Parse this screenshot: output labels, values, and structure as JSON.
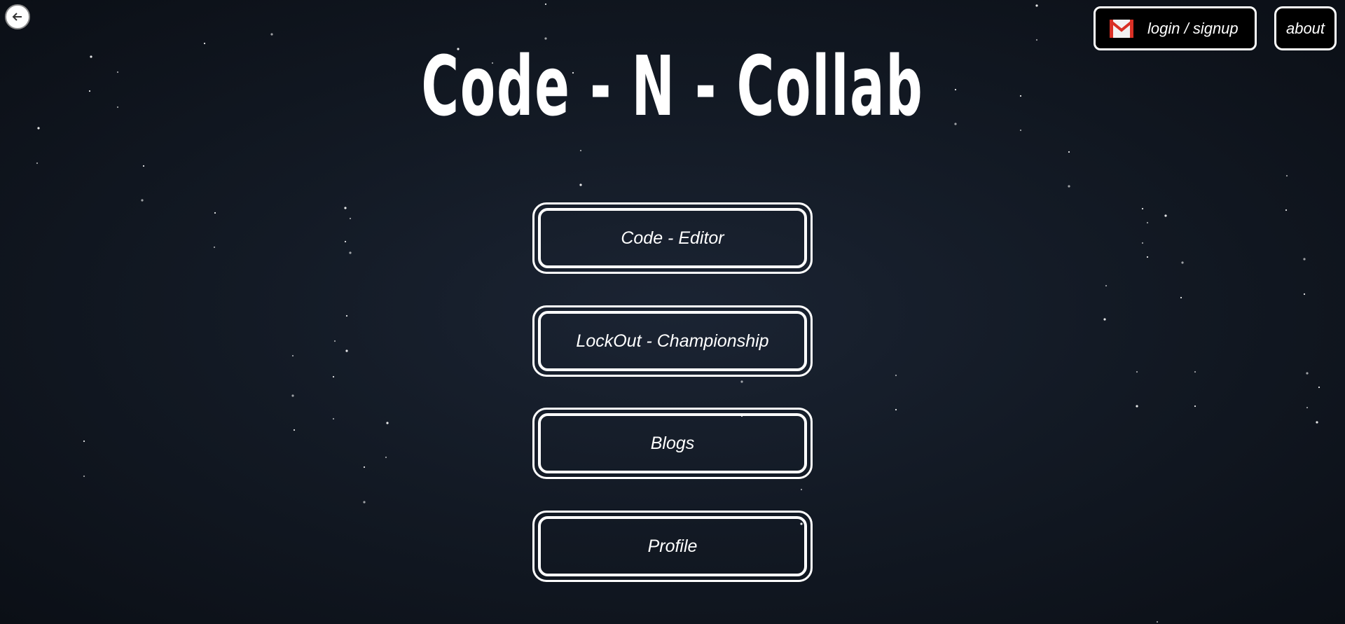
{
  "app": {
    "title": "Code - N - Collab"
  },
  "header": {
    "back_icon": "arrow-left-icon",
    "login_icon": "gmail-icon",
    "login_label": "login / signup",
    "about_label": "about"
  },
  "menu": {
    "items": [
      {
        "label": "Code - Editor"
      },
      {
        "label": "LockOut - Championship"
      },
      {
        "label": "Blogs"
      },
      {
        "label": "Profile"
      }
    ]
  },
  "colors": {
    "background": "#131a25",
    "text": "#ffffff",
    "border": "#ffffff",
    "gmail_red": "#d93025"
  }
}
